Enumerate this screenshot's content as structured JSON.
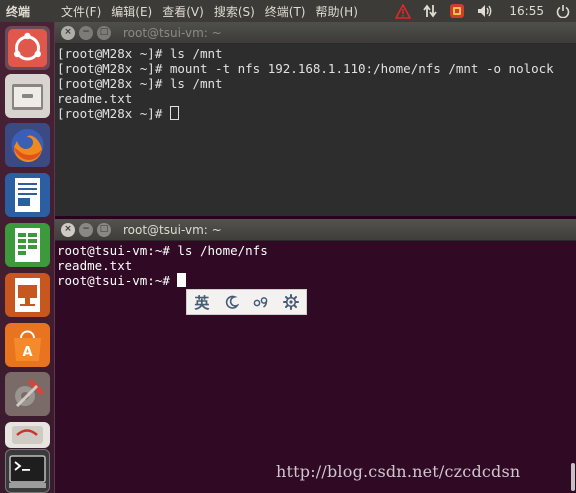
{
  "top_panel": {
    "app_name": "终端",
    "menu": [
      "文件(F)",
      "编辑(E)",
      "查看(V)",
      "搜索(S)",
      "终端(T)",
      "帮助(H)"
    ],
    "clock": "16:55"
  },
  "launcher": {
    "items": [
      "ubuntu-dash",
      "files",
      "firefox",
      "libreoffice-writer",
      "libreoffice-calc",
      "libreoffice-impress",
      "ubuntu-software",
      "system-settings",
      "removable-drive",
      "terminal"
    ]
  },
  "window1": {
    "title": "root@tsui-vm: ~",
    "lines": [
      "[root@M28x ~]# ls /mnt",
      "[root@M28x ~]# mount -t nfs 192.168.1.110:/home/nfs /mnt -o nolock",
      "[root@M28x ~]# ls /mnt",
      "readme.txt"
    ],
    "prompt": "[root@M28x ~]# "
  },
  "window2": {
    "title": "root@tsui-vm: ~",
    "lines": [
      "root@tsui-vm:~# ls /home/nfs",
      "readme.txt"
    ],
    "prompt": "root@tsui-vm:~# "
  },
  "ime": {
    "lang_label": "英",
    "buttons": [
      "moon-icon",
      "punctuation-icon",
      "gear-icon"
    ]
  },
  "watermark": "http://blog.csdn.net/czcdcdsn",
  "colors": {
    "terminal_purple": "#300a24",
    "terminal_dark": "#2d2d2d",
    "panel": "#3c3b37",
    "accent_orange": "#e95420"
  }
}
